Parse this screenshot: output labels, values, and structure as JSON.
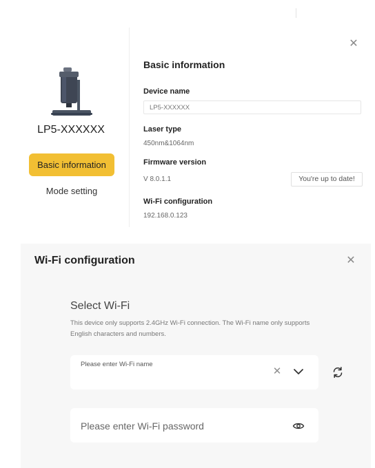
{
  "device": {
    "name": "LP5-XXXXXX"
  },
  "nav": {
    "basic_information": "Basic information",
    "mode_setting": "Mode setting"
  },
  "basic_info": {
    "heading": "Basic information",
    "device_name_label": "Device name",
    "device_name_value": "LP5-XXXXXX",
    "laser_type_label": "Laser type",
    "laser_type_value": "450nm&1064nm",
    "firmware_label": "Firmware version",
    "firmware_value": "V 8.0.1.1",
    "update_status": "You're up to date!",
    "wifi_label": "Wi-Fi configuration",
    "wifi_value": "192.168.0.123"
  },
  "wifi_dialog": {
    "title": "Wi-Fi configuration",
    "select_title": "Select Wi-Fi",
    "description": "This device only supports 2.4GHz Wi-Fi connection. The Wi-Fi name only supports English characters and numbers.",
    "name_placeholder": "Please enter Wi-Fi name",
    "password_placeholder": "Please enter Wi-Fi password"
  },
  "icons": {
    "close": "close-icon",
    "clear": "clear-icon",
    "dropdown": "chevron-down-icon",
    "refresh": "refresh-icon",
    "visibility": "eye-icon"
  },
  "colors": {
    "accent": "#f2bf33",
    "panel_bg": "#f7f7f7"
  }
}
